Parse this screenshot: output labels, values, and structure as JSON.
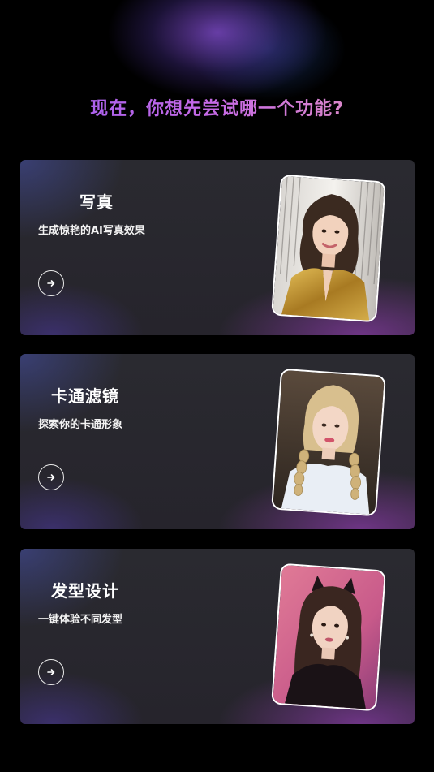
{
  "header": {
    "question": "现在，你想先尝试哪一个功能?"
  },
  "cards": [
    {
      "title": "写真",
      "subtitle": "生成惊艳的AI写真效果",
      "button_icon": "arrow-right-icon",
      "photo": "portrait-photo-gold-blazer"
    },
    {
      "title": "卡通滤镜",
      "subtitle": "探索你的卡通形象",
      "button_icon": "arrow-right-icon",
      "photo": "portrait-photo-blonde-braids"
    },
    {
      "title": "发型设计",
      "subtitle": "一键体验不同发型",
      "button_icon": "arrow-right-icon",
      "photo": "portrait-photo-cat-ears"
    }
  ],
  "colors": {
    "background": "#000000",
    "headline_gradient_start": "#9a5cf0",
    "headline_gradient_end": "#e79ab8",
    "card_base": "#27262d",
    "card_glow_purple": "#8c3caa",
    "card_glow_blue": "#4650aa"
  }
}
